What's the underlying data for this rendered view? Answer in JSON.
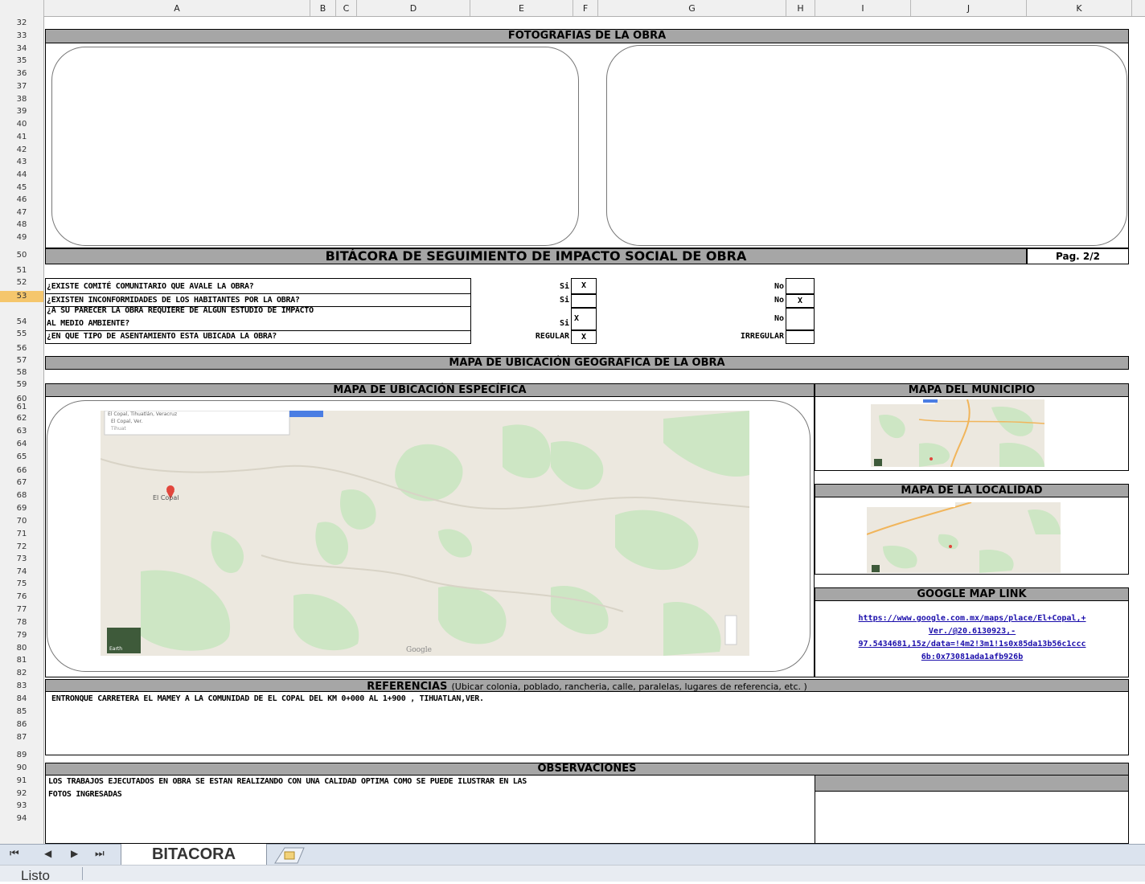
{
  "columns": [
    "A",
    "B",
    "C",
    "D",
    "E",
    "F",
    "G",
    "H",
    "I",
    "J",
    "K"
  ],
  "rows": [
    "32",
    "33",
    "34",
    "35",
    "36",
    "37",
    "38",
    "39",
    "40",
    "41",
    "42",
    "43",
    "44",
    "45",
    "46",
    "47",
    "48",
    "49",
    "50",
    "51",
    "52",
    "53",
    "54",
    "55",
    "56",
    "57",
    "58",
    "59",
    "60",
    "61",
    "62",
    "63",
    "64",
    "65",
    "66",
    "67",
    "68",
    "69",
    "70",
    "71",
    "72",
    "73",
    "74",
    "75",
    "76",
    "77",
    "78",
    "79",
    "80",
    "81",
    "82",
    "83",
    "84",
    "85",
    "86",
    "87",
    "89",
    "90",
    "91",
    "92",
    "93",
    "94"
  ],
  "selected_row": "53",
  "sections": {
    "fotos_title": "FOTOGRAFIAS DE LA OBRA",
    "bitacora_title": "BITÁCORA DE SEGUIMIENTO DE IMPACTO SOCIAL DE OBRA",
    "page_label": "Pag. 2/2",
    "mapa_geo_title": "MAPA DE UBICACIÓN GEOGRAFICA DE LA OBRA",
    "mapa_especifica_title": "MAPA DE UBICACIÓN ESPECÍFICA",
    "mapa_municipio_title": "MAPA DEL MUNICIPIO",
    "mapa_localidad_title": "MAPA DE LA LOCALIDAD",
    "google_link_title": "GOOGLE MAP LINK",
    "referencias_title": "REFERENCIAS",
    "referencias_hint": "(Ubicar colonia, poblado, rancheria, calle, paralelas, lugares de referencia, etc. )",
    "referencias_text": "ENTRONQUE CARRETERA EL MAMEY A LA COMUNIDAD DE EL COPAL DEL KM 0+000 AL 1+900 , TIHUATLAN,VER.",
    "observaciones_title": "OBSERVACIONES",
    "observaciones_text_1": "LOS TRABAJOS EJECUTADOS EN OBRA SE ESTAN REALIZANDO CON UNA CALIDAD OPTIMA COMO SE PUEDE ILUSTRAR EN LAS",
    "observaciones_text_2": "FOTOS INGRESADAS"
  },
  "questions": [
    {
      "text": "¿EXISTE COMITÉ COMUNITARIO QUE AVALE LA OBRA?",
      "yes_label": "Si",
      "yes_value": "X",
      "no_label": "No",
      "no_value": ""
    },
    {
      "text": "¿EXISTEN INCONFORMIDADES DE LOS HABITANTES  POR LA OBRA?",
      "yes_label": "Si",
      "yes_value": "",
      "no_label": "No",
      "no_value": "X"
    },
    {
      "text_1": "¿A SU PARECER LA OBRA REQUIERE DE ALGUN ESTUDIO DE IMPACTO",
      "text_2": "AL MEDIO AMBIENTE?",
      "yes_label": "Si",
      "yes_value": "X",
      "no_label": "No",
      "no_value": ""
    },
    {
      "text": "¿EN QUE TIPO DE ASENTAMIENTO ESTA UBICADA LA OBRA?",
      "yes_label": "REGULAR",
      "yes_value": "X",
      "no_label": "IRREGULAR",
      "no_value": ""
    }
  ],
  "map": {
    "place_label": "El Copal",
    "search_text": "El Copal, Tihuatlán, Veracruz",
    "suggestion_1": "El Copal, Ver.",
    "suggestion_2": "Tihuat",
    "watermark": "Google",
    "earth_label": "Earth"
  },
  "google_link": {
    "line1": "https://www.google.com.mx/maps/place/El+Copal,+",
    "line2": "Ver./@20.6130923,-",
    "line3": "97.5434681,15z/data=!4m2!3m1!1s0x85da13b56c1ccc",
    "line4": "6b:0x73081ada1afb926b"
  },
  "sheet_tabs": {
    "active": "BITACORA"
  },
  "status": {
    "text": "Listo"
  },
  "colors": {
    "band": "#a6a6a6",
    "green": "#cde6c4",
    "land": "#ece8df",
    "link": "#1a0dab"
  }
}
